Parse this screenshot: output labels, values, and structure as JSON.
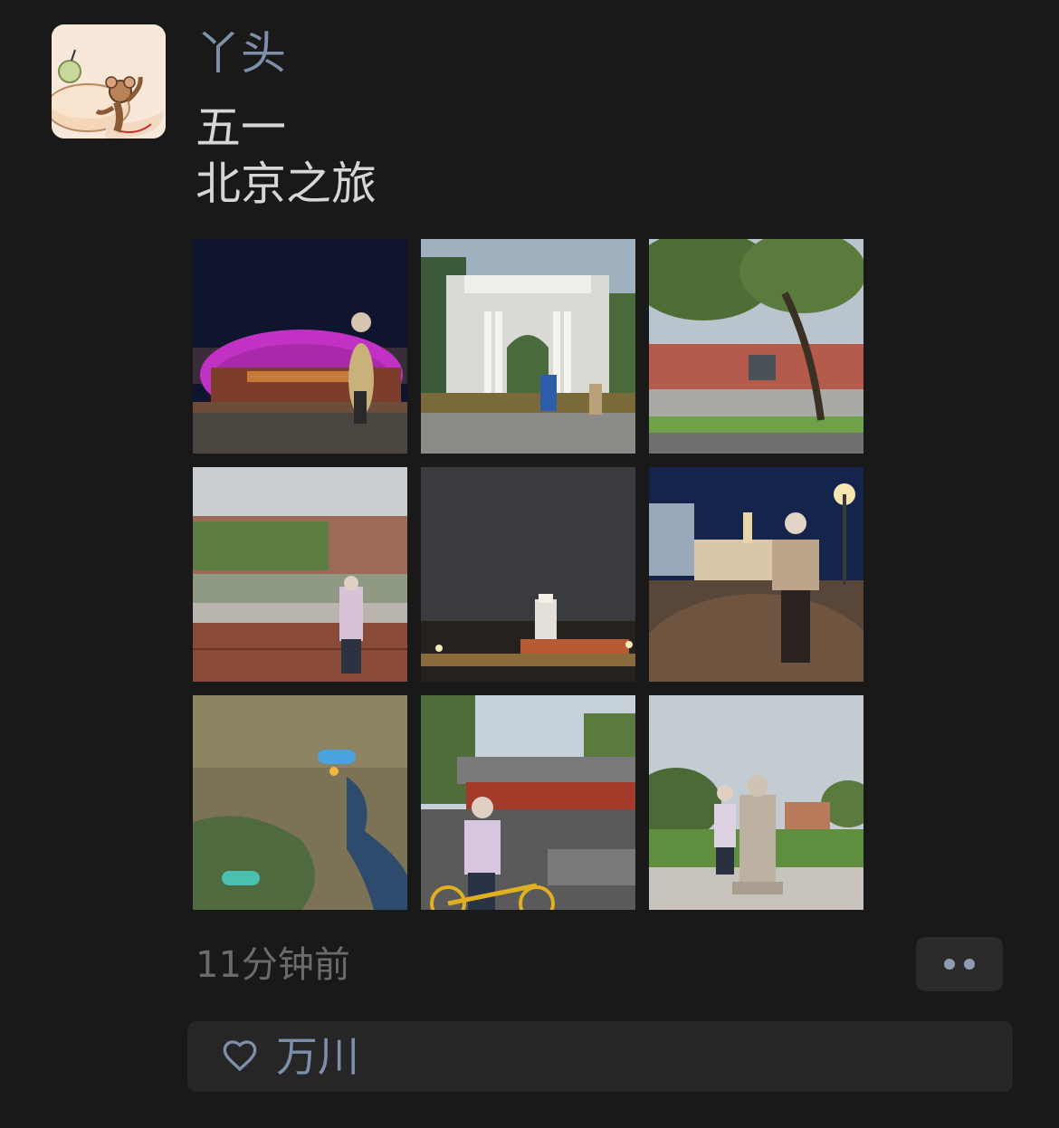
{
  "post": {
    "username": "丫头",
    "text": "五一\n北京之旅",
    "timestamp": "11分钟前",
    "avatar_icon": "cartoon-mouse-avatar-icon",
    "photos": [
      {
        "name": "photo-1",
        "subject": "night-opera-house"
      },
      {
        "name": "photo-2",
        "subject": "white-gate"
      },
      {
        "name": "photo-3",
        "subject": "tree-and-buildings"
      },
      {
        "name": "photo-4",
        "subject": "brick-wall-campus"
      },
      {
        "name": "photo-5",
        "subject": "night-square-monument"
      },
      {
        "name": "photo-6",
        "subject": "night-street"
      },
      {
        "name": "photo-7",
        "subject": "map"
      },
      {
        "name": "photo-8",
        "subject": "bicycle-gate"
      },
      {
        "name": "photo-9",
        "subject": "stone-monument-lawn"
      }
    ]
  },
  "likes": {
    "icon": "heart-icon",
    "names": "万川"
  },
  "colors": {
    "background": "#191919",
    "link": "#7d90a9",
    "text": "#d6d6d6",
    "muted": "#6b6b6b",
    "panel": "#262626"
  }
}
